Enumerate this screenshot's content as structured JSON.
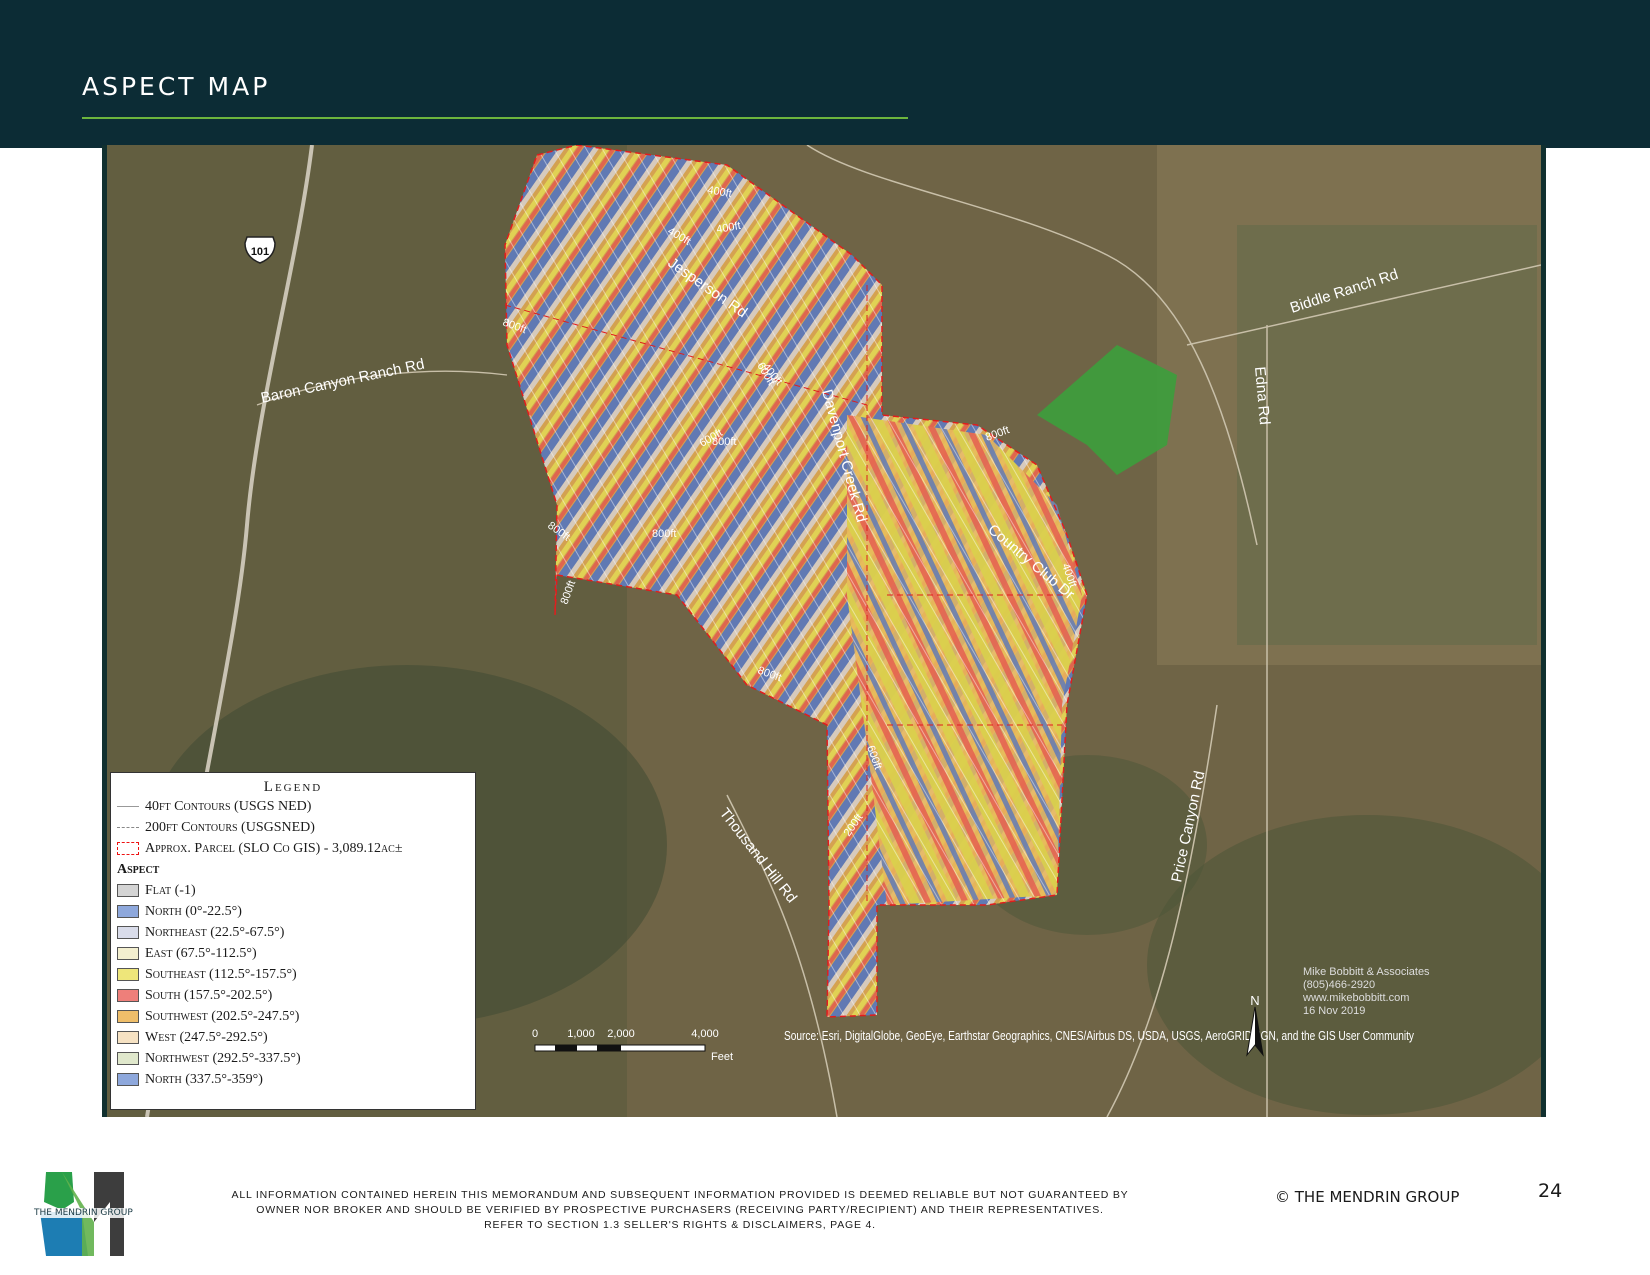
{
  "header": {
    "title": "ASPECT MAP"
  },
  "map": {
    "roads": {
      "highway_shield": "101",
      "baron_canyon": "Baron Canyon Ranch Rd",
      "jesperson": "Jesperson Rd",
      "davenport": "Davenport Creek Rd",
      "country_club": "Country Club Dr",
      "biddle_ranch": "Biddle Ranch Rd",
      "edna": "Edna Rd",
      "thousand_hill": "Thousand Hill Rd",
      "price_canyon": "Price Canyon Rd"
    },
    "contour_labels": [
      "400ft",
      "400ft",
      "400ft",
      "600ft",
      "600ft",
      "800ft",
      "800ft",
      "800ft",
      "800ft",
      "800ft",
      "800ft",
      "800ft",
      "400ft",
      "600ft",
      "400ft",
      "200ft"
    ],
    "scale_bar": {
      "ticks": [
        "0",
        "1,000",
        "2,000",
        "4,000"
      ],
      "unit": "Feet"
    },
    "north_arrow": "N",
    "source_text": "Source: Esri, DigitalGlobe, GeoEye, Earthstar Geographics, CNES/Airbus DS, USDA, USGS, AeroGRID, IGN, and the GIS User Community",
    "credit": {
      "firm": "Mike Bobbitt & Associates",
      "phone": "(805)466-2920",
      "website": "www.mikebobbitt.com",
      "date": "16 Nov 2019"
    }
  },
  "legend": {
    "title": "Legend",
    "contour_40": "40ft Contours (USGS NED)",
    "contour_200": "200ft Contours (USGSNED)",
    "parcel": "Approx. Parcel (SLO Co GIS) - 3,089.12ac±",
    "aspect_heading": "Aspect",
    "aspect_classes": [
      {
        "label": "Flat (-1)",
        "color": "#d4d4d4"
      },
      {
        "label": "North (0°-22.5°)",
        "color": "#8ea8dc"
      },
      {
        "label": "Northeast (22.5°-67.5°)",
        "color": "#d9dcea"
      },
      {
        "label": "East (67.5°-112.5°)",
        "color": "#f3efcf"
      },
      {
        "label": "Southeast (112.5°-157.5°)",
        "color": "#eee67a"
      },
      {
        "label": "South (157.5°-202.5°)",
        "color": "#ee7f7a"
      },
      {
        "label": "Southwest (202.5°-247.5°)",
        "color": "#efbe6a"
      },
      {
        "label": "West (247.5°-292.5°)",
        "color": "#f6e2c3"
      },
      {
        "label": "Northwest (292.5°-337.5°)",
        "color": "#e0e8cc"
      },
      {
        "label": "North (337.5°-359°)",
        "color": "#8ea8dc"
      }
    ]
  },
  "footer": {
    "disclaimer_line1": "ALL INFORMATION CONTAINED HEREIN THIS MEMORANDUM AND SUBSEQUENT INFORMATION PROVIDED IS DEEMED RELIABLE BUT NOT GUARANTEED BY",
    "disclaimer_line2": "OWNER NOR BROKER AND SHOULD BE VERIFIED BY PROSPECTIVE PURCHASERS (RECEIVING PARTY/RECIPIENT) AND THEIR REPRESENTATIVES.",
    "disclaimer_line3": "REFER TO SECTION 1.3 SELLER'S RIGHTS & DISCLAIMERS, PAGE 4.",
    "copyright": "© THE MENDRIN GROUP",
    "page_number": "24",
    "logo_text": "THE MENDRIN GROUP"
  }
}
